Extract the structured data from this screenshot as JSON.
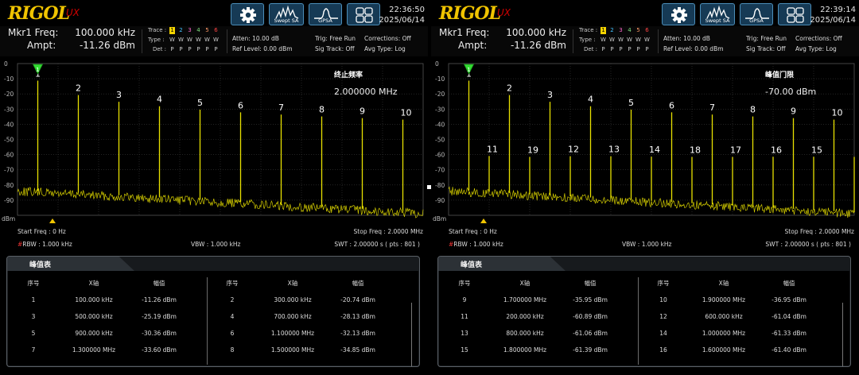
{
  "colors": {
    "trace": "#e8e000",
    "marker": "#33dd33",
    "accent_btn": "#163a55",
    "grid": "#3a3a3a",
    "brand": "#f0c400"
  },
  "panels": [
    {
      "brand": "RIGOL",
      "brand_sub": "UX",
      "buttons": [
        {
          "icon": "gear-icon",
          "label": ""
        },
        {
          "icon": "swept-sa-icon",
          "label": "Swept SA"
        },
        {
          "icon": "gpsa-icon",
          "label": "GPSA"
        },
        {
          "icon": "window-layout-icon",
          "label": ""
        }
      ],
      "time": "22:36:50",
      "date": "2025/06/14",
      "marker": {
        "freq_label": "Mkr1 Freq:",
        "freq_value": "100.000 kHz",
        "ampt_label": "Ampt:",
        "ampt_value": "-11.26 dBm"
      },
      "trace": {
        "trace_label": "Trace :",
        "type_label": "Type :",
        "det_label": "Det :",
        "numbers": [
          "1",
          "2",
          "3",
          "4",
          "5",
          "6"
        ],
        "number_colors": [
          "#f5d400",
          "#40c0ff",
          "#ff66cc",
          "#80e080",
          "#ff9966",
          "#ff4444"
        ],
        "types": [
          "W",
          "W",
          "W",
          "W",
          "W",
          "W"
        ],
        "dets": [
          "P",
          "P",
          "P",
          "P",
          "P",
          "P"
        ]
      },
      "status": {
        "atten": "Atten: 10.00 dB",
        "ref": "Ref Level: 0.00 dBm",
        "trig": "Trig: Free Run",
        "sig": "Sig Track: Off",
        "corr": "Corrections: Off",
        "avg": "Avg Type: Log"
      },
      "annotation": {
        "title": "终止频率",
        "value": "2.000000 MHz"
      },
      "bottom": {
        "start": "Start Freq : 0 Hz",
        "stop": "Stop Freq : 2.0000 MHz",
        "rbw_mark": "#",
        "rbw": "RBW : 1.000 kHz",
        "vbw": "VBW : 1.000 kHz",
        "swt": "SWT : 2.00000 s ( pts : 801 )"
      },
      "peak_table": {
        "title": "峰值表",
        "headers": [
          "序号",
          "X轴",
          "幅值",
          "序号",
          "X轴",
          "幅值"
        ],
        "rows": [
          [
            "1",
            "100.000 kHz",
            "-11.26 dBm",
            "2",
            "300.000 kHz",
            "-20.74 dBm"
          ],
          [
            "3",
            "500.000 kHz",
            "-25.19 dBm",
            "4",
            "700.000 kHz",
            "-28.13 dBm"
          ],
          [
            "5",
            "900.000 kHz",
            "-30.36 dBm",
            "6",
            "1.100000 MHz",
            "-32.13 dBm"
          ],
          [
            "7",
            "1.300000 MHz",
            "-33.60 dBm",
            "8",
            "1.500000 MHz",
            "-34.85 dBm"
          ]
        ]
      }
    },
    {
      "brand": "RIGOL",
      "brand_sub": "UX",
      "buttons": [
        {
          "icon": "gear-icon",
          "label": ""
        },
        {
          "icon": "swept-sa-icon",
          "label": "Swept SA"
        },
        {
          "icon": "gpsa-icon",
          "label": "GPSA"
        },
        {
          "icon": "window-layout-icon",
          "label": ""
        }
      ],
      "time": "22:39:14",
      "date": "2025/06/14",
      "marker": {
        "freq_label": "Mkr1 Freq:",
        "freq_value": "100.000 kHz",
        "ampt_label": "Ampt:",
        "ampt_value": "-11.26 dBm"
      },
      "trace": {
        "trace_label": "Trace :",
        "type_label": "Type :",
        "det_label": "Det :",
        "numbers": [
          "1",
          "2",
          "3",
          "4",
          "5",
          "6"
        ],
        "number_colors": [
          "#f5d400",
          "#40c0ff",
          "#ff66cc",
          "#80e080",
          "#ff9966",
          "#ff4444"
        ],
        "types": [
          "W",
          "W",
          "W",
          "W",
          "W",
          "W"
        ],
        "dets": [
          "P",
          "P",
          "P",
          "P",
          "P",
          "P"
        ]
      },
      "status": {
        "atten": "Atten: 10.00 dB",
        "ref": "Ref Level: 0.00 dBm",
        "trig": "Trig: Free Run",
        "sig": "Sig Track: Off",
        "corr": "Corrections: Off",
        "avg": "Avg Type: Log"
      },
      "annotation": {
        "title": "峰值门限",
        "value": "-70.00 dBm"
      },
      "bottom": {
        "start": "Start Freq : 0 Hz",
        "stop": "Stop Freq : 2.0000 MHz",
        "rbw_mark": "#",
        "rbw": "RBW : 1.000 kHz",
        "vbw": "VBW : 1.000 kHz",
        "swt": "SWT : 2.00000 s ( pts : 801 )"
      },
      "peak_table": {
        "title": "峰值表",
        "headers": [
          "序号",
          "X轴",
          "幅值",
          "序号",
          "X轴",
          "幅值"
        ],
        "rows": [
          [
            "9",
            "1.700000 MHz",
            "-35.95 dBm",
            "10",
            "1.900000 MHz",
            "-36.95 dBm"
          ],
          [
            "11",
            "200.000 kHz",
            "-60.89 dBm",
            "12",
            "600.000 kHz",
            "-61.04 dBm"
          ],
          [
            "13",
            "800.000 kHz",
            "-61.06 dBm",
            "14",
            "1.000000 MHz",
            "-61.33 dBm"
          ],
          [
            "15",
            "1.800000 MHz",
            "-61.39 dBm",
            "16",
            "1.600000 MHz",
            "-61.40 dBm"
          ]
        ]
      }
    }
  ],
  "chart_data": [
    {
      "type": "line",
      "ylabel": "dBm",
      "ylim": [
        -100,
        0
      ],
      "xlim_hz": [
        0,
        2000000
      ],
      "y_ticks": [
        "0",
        "-10",
        "-20",
        "-30",
        "-40",
        "-50",
        "-60",
        "-70",
        "-80",
        "-90"
      ],
      "grid": true,
      "noise_floor_dbm": [
        -80,
        -95
      ],
      "peaks": [
        {
          "label": "1",
          "x_hz": 100000,
          "y_dbm": -11.26
        },
        {
          "label": "2",
          "x_hz": 300000,
          "y_dbm": -20.74
        },
        {
          "label": "3",
          "x_hz": 500000,
          "y_dbm": -25.19
        },
        {
          "label": "4",
          "x_hz": 700000,
          "y_dbm": -28.13
        },
        {
          "label": "5",
          "x_hz": 900000,
          "y_dbm": -30.36
        },
        {
          "label": "6",
          "x_hz": 1100000,
          "y_dbm": -32.13
        },
        {
          "label": "7",
          "x_hz": 1300000,
          "y_dbm": -33.6
        },
        {
          "label": "8",
          "x_hz": 1500000,
          "y_dbm": -34.85
        },
        {
          "label": "9",
          "x_hz": 1700000,
          "y_dbm": -35.95
        },
        {
          "label": "10",
          "x_hz": 1900000,
          "y_dbm": -36.95
        }
      ]
    },
    {
      "type": "line",
      "ylabel": "dBm",
      "ylim": [
        -100,
        0
      ],
      "xlim_hz": [
        0,
        2000000
      ],
      "y_ticks": [
        "0",
        "-10",
        "-20",
        "-30",
        "-40",
        "-50",
        "-60",
        "-70",
        "-80",
        "-90"
      ],
      "grid": true,
      "noise_floor_dbm": [
        -80,
        -95
      ],
      "peaks": [
        {
          "label": "1",
          "x_hz": 100000,
          "y_dbm": -11.26
        },
        {
          "label": "11",
          "x_hz": 200000,
          "y_dbm": -60.89
        },
        {
          "label": "2",
          "x_hz": 300000,
          "y_dbm": -20.74
        },
        {
          "label": "19",
          "x_hz": 400000,
          "y_dbm": -61.5
        },
        {
          "label": "3",
          "x_hz": 500000,
          "y_dbm": -25.19
        },
        {
          "label": "12",
          "x_hz": 600000,
          "y_dbm": -61.04
        },
        {
          "label": "4",
          "x_hz": 700000,
          "y_dbm": -28.13
        },
        {
          "label": "13",
          "x_hz": 800000,
          "y_dbm": -61.06
        },
        {
          "label": "5",
          "x_hz": 900000,
          "y_dbm": -30.36
        },
        {
          "label": "14",
          "x_hz": 1000000,
          "y_dbm": -61.33
        },
        {
          "label": "6",
          "x_hz": 1100000,
          "y_dbm": -32.13
        },
        {
          "label": "18",
          "x_hz": 1200000,
          "y_dbm": -61.5
        },
        {
          "label": "7",
          "x_hz": 1300000,
          "y_dbm": -33.6
        },
        {
          "label": "17",
          "x_hz": 1400000,
          "y_dbm": -61.5
        },
        {
          "label": "8",
          "x_hz": 1500000,
          "y_dbm": -34.85
        },
        {
          "label": "16",
          "x_hz": 1600000,
          "y_dbm": -61.4
        },
        {
          "label": "9",
          "x_hz": 1700000,
          "y_dbm": -35.95
        },
        {
          "label": "15",
          "x_hz": 1800000,
          "y_dbm": -61.39
        },
        {
          "label": "10",
          "x_hz": 1900000,
          "y_dbm": -36.95
        },
        {
          "label": "",
          "x_hz": 2000000,
          "y_dbm": -61.5
        }
      ]
    }
  ]
}
